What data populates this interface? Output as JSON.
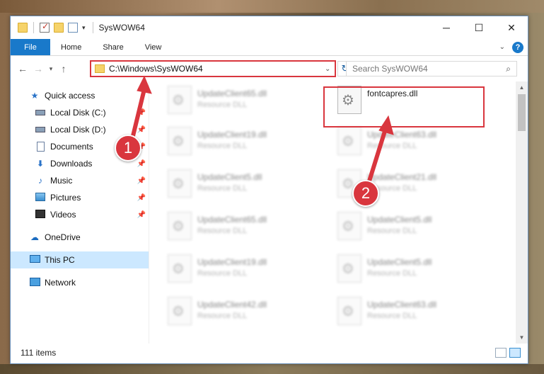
{
  "window": {
    "title": "SysWOW64"
  },
  "ribbon": {
    "tabs": [
      "File",
      "Home",
      "Share",
      "View"
    ],
    "help": "?"
  },
  "address": {
    "path": "C:\\Windows\\SysWOW64"
  },
  "search": {
    "placeholder": "Search SysWOW64"
  },
  "sidebar": {
    "quick_access": "Quick access",
    "items": [
      "Local Disk (C:)",
      "Local Disk (D:)",
      "Documents",
      "Downloads",
      "Music",
      "Pictures",
      "Videos"
    ],
    "onedrive": "OneDrive",
    "this_pc": "This PC",
    "network": "Network"
  },
  "files": {
    "left_column": [
      {
        "name": "UpdateClient65.dll",
        "type": "Resource DLL"
      },
      {
        "name": "UpdateClient19.dll",
        "type": "Resource DLL"
      },
      {
        "name": "UpdateClient5.dll",
        "type": "Resource DLL"
      },
      {
        "name": "UpdateClient65.dll",
        "type": "Resource DLL"
      },
      {
        "name": "UpdateClient19.dll",
        "type": "Resource DLL"
      },
      {
        "name": "UpdateClient42.dll",
        "type": "Resource DLL"
      }
    ],
    "right_column": [
      {
        "name": "fontcapres.dll",
        "type": ""
      },
      {
        "name": "UpdateClient63.dll",
        "type": "Resource DLL"
      },
      {
        "name": "UpdateClient21.dll",
        "type": "Resource DLL"
      },
      {
        "name": "UpdateClient5.dll",
        "type": "Resource DLL"
      },
      {
        "name": "UpdateClient5.dll",
        "type": "Resource DLL"
      },
      {
        "name": "UpdateClient63.dll",
        "type": "Resource DLL"
      }
    ]
  },
  "status": {
    "count": "111 items"
  },
  "callouts": {
    "one": "1",
    "two": "2"
  },
  "colors": {
    "accent": "#1979ca",
    "annotation": "#d9363e",
    "selected": "#cce8ff"
  }
}
